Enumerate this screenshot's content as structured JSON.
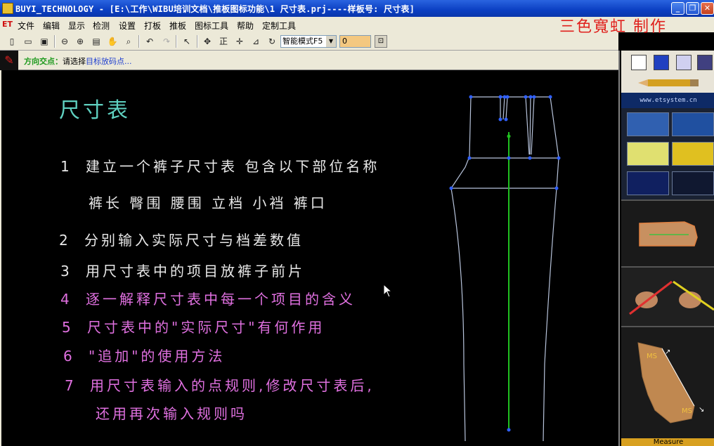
{
  "window": {
    "title": "BUYI_TECHNOLOGY - [E:\\工作\\WIBU培训文档\\推板图标功能\\1 尺寸表.prj----样板号: 尺寸表]",
    "min_label": "_",
    "max_label": "❐",
    "close_label": "✕"
  },
  "menu": {
    "logo": "ET",
    "items": [
      "文件",
      "编辑",
      "显示",
      "检测",
      "设置",
      "打板",
      "推板",
      "图标工具",
      "帮助",
      "定制工具"
    ]
  },
  "watermark": "三色寬虹 制作",
  "toolbar": {
    "mode": "智能模式F5",
    "value": "0",
    "mode_arrow": "▼",
    "confirm_label": "⊡"
  },
  "status": {
    "prefix": "方向交点：",
    "text": "请选择",
    "target": "目标放码点..."
  },
  "content": {
    "title": "尺寸表",
    "lines": [
      {
        "num": "1",
        "text": "建立一个裤子尺寸表  包含以下部位名称",
        "color": "#e8e8e8"
      },
      {
        "num": "",
        "text": "裤长  臀围  腰围  立档  小裆  裤口",
        "color": "#e8e8e8"
      },
      {
        "num": "2",
        "text": "分别输入实际尺寸与档差数值",
        "color": "#e8e8e8"
      },
      {
        "num": "3",
        "text": "用尺寸表中的项目放裤子前片",
        "color": "#e8e8e8"
      },
      {
        "num": "4",
        "text": "逐一解释尺寸表中每一个项目的含义",
        "color": "#e070e0"
      },
      {
        "num": "5",
        "text": "尺寸表中的\"实际尺寸\"有何作用",
        "color": "#e070e0"
      },
      {
        "num": "6",
        "text": "\"追加\"的使用方法",
        "color": "#e070e0"
      },
      {
        "num": "7",
        "text": "用尺寸表输入的点规则,修改尺寸表后,",
        "color": "#e070e0"
      },
      {
        "num": "",
        "text": "还用再次输入规则吗",
        "color": "#e070e0"
      }
    ]
  },
  "right_panel": {
    "url": "www.etsystem.cn",
    "shape_label_a": "MS",
    "shape_label_b": "MS",
    "measure_label": "Measure"
  },
  "colors": {
    "title_cyan": "#5fd0c0",
    "pink": "#e070e0",
    "pattern_line": "#b8c4dc",
    "grain_line": "#20c020",
    "point_blue": "#3060ff"
  }
}
